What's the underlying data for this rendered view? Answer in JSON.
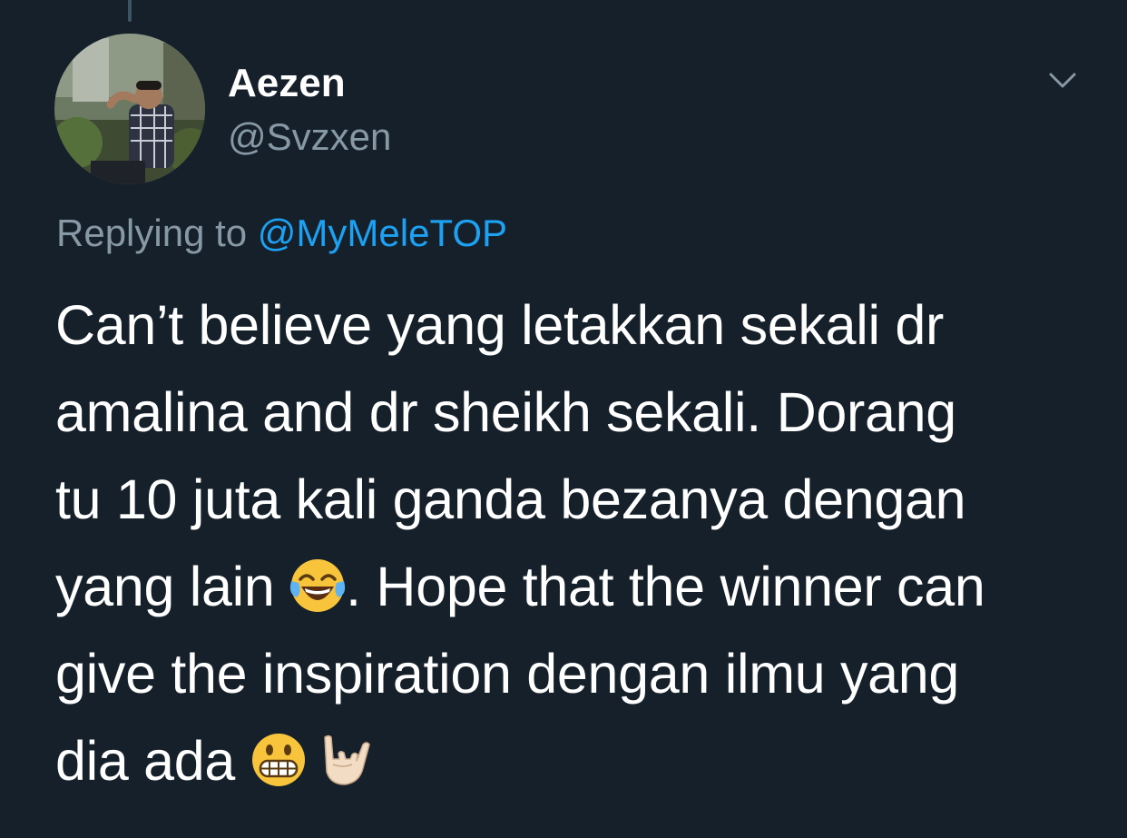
{
  "author": {
    "display_name": "Aezen",
    "handle": "@Svzxen"
  },
  "reply": {
    "prefix": "Replying to",
    "mention": "@MyMeleTOP"
  },
  "tweet": {
    "line1": "Can’t believe yang letakkan sekali dr",
    "line2": "amalina and dr sheikh sekali. Dorang",
    "line3": "tu 10 juta kali ganda bezanya dengan",
    "line4_start": "yang lain ",
    "line4_end": ". Hope that the winner can",
    "line5": "give the inspiration dengan ilmu yang",
    "line6": "dia ada "
  },
  "icons": {
    "caret": "chevron-down-icon",
    "emoji_1": "face-with-tears-of-joy-icon",
    "emoji_2": "grimacing-face-icon",
    "emoji_3": "sign-of-the-horns-icon"
  },
  "colors": {
    "background": "#15202b",
    "primary_text": "#ffffff",
    "secondary_text": "#8899a6",
    "link": "#1da1f2"
  }
}
